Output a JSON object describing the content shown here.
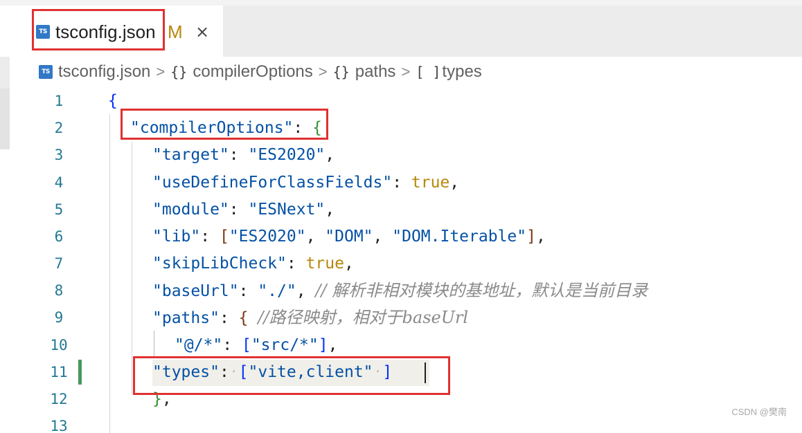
{
  "tab": {
    "icon": "ts-icon",
    "icon_text": "TS",
    "filename": "tsconfig.json",
    "modified": "M",
    "close": "×"
  },
  "breadcrumb": {
    "file": "tsconfig.json",
    "items": [
      "compilerOptions",
      "paths",
      "types"
    ],
    "sym_object": "{}",
    "sym_array": "[ ]",
    "separator": ">"
  },
  "editor": {
    "lines": [
      {
        "no": "1"
      },
      {
        "no": "2"
      },
      {
        "no": "3"
      },
      {
        "no": "4"
      },
      {
        "no": "5"
      },
      {
        "no": "6"
      },
      {
        "no": "7"
      },
      {
        "no": "8"
      },
      {
        "no": "9"
      },
      {
        "no": "10"
      },
      {
        "no": "11"
      },
      {
        "no": "12"
      },
      {
        "no": "13"
      }
    ],
    "tokens": {
      "l2_key": "\"compilerOptions\"",
      "l3_key": "\"target\"",
      "l3_val": "\"ES2020\"",
      "l4_key": "\"useDefineForClassFields\"",
      "l4_val": "true",
      "l5_key": "\"module\"",
      "l5_val": "\"ESNext\"",
      "l6_key": "\"lib\"",
      "l6_v1": "\"ES2020\"",
      "l6_v2": "\"DOM\"",
      "l6_v3": "\"DOM.Iterable\"",
      "l7_key": "\"skipLibCheck\"",
      "l7_val": "true",
      "l8_key": "\"baseUrl\"",
      "l8_val": "\"./\"",
      "l8_comment": "// 解析非相对模块的基地址，默认是当前目录",
      "l9_key": "\"paths\"",
      "l9_comment": "//路径映射，相对于baseUrl",
      "l10_key": "\"@/*\"",
      "l10_val": "\"src/*\"",
      "l11_key": "\"types\"",
      "l11_val": "\"vite,client\""
    }
  },
  "watermark": "CSDN @樊南",
  "colors": {
    "accent_highlight": "#e03131",
    "git_modified": "#48985d",
    "ts_icon": "#3178c6"
  }
}
